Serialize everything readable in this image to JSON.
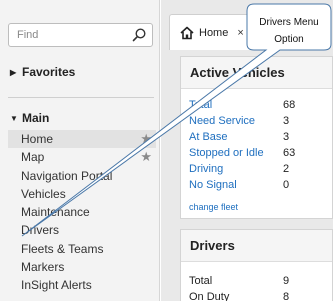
{
  "search": {
    "placeholder": "Find"
  },
  "sidebar": {
    "favorites_label": "Favorites",
    "main_label": "Main",
    "items": [
      {
        "label": "Home",
        "starred": true,
        "active": true
      },
      {
        "label": "Map",
        "starred": true,
        "active": false
      },
      {
        "label": "Navigation Portal",
        "starred": false,
        "active": false
      },
      {
        "label": "Vehicles",
        "starred": false,
        "active": false
      },
      {
        "label": "Maintenance",
        "starred": false,
        "active": false
      },
      {
        "label": "Drivers",
        "starred": false,
        "active": false
      },
      {
        "label": "Fleets & Teams",
        "starred": false,
        "active": false
      },
      {
        "label": "Markers",
        "starred": false,
        "active": false
      },
      {
        "label": "InSight Alerts",
        "starred": false,
        "active": false
      }
    ]
  },
  "tab": {
    "label": "Home",
    "close": "×"
  },
  "vehicles_card": {
    "title": "Active Vehicles",
    "rows": [
      {
        "label": "Total",
        "value": "68"
      },
      {
        "label": "Need Service",
        "value": "3"
      },
      {
        "label": "At Base",
        "value": "3"
      },
      {
        "label": "Stopped or Idle",
        "value": "63"
      },
      {
        "label": "Driving",
        "value": "2"
      },
      {
        "label": "No Signal",
        "value": "0"
      }
    ],
    "link": "change fleet"
  },
  "drivers_card": {
    "title": "Drivers",
    "rows": [
      {
        "label": "Total",
        "value": "9"
      },
      {
        "label": "On Duty",
        "value": "8"
      }
    ]
  },
  "callout": {
    "line1": "Drivers Menu",
    "line2": "Option"
  },
  "colors": {
    "link": "#1f6fbf",
    "sidebar_bg": "#f3f3f3",
    "active_item_bg": "#e2e2e2",
    "panel_bg": "#e9e9e9"
  },
  "icons": {
    "search": "search-icon",
    "home": "home-icon",
    "star": "star-icon"
  }
}
